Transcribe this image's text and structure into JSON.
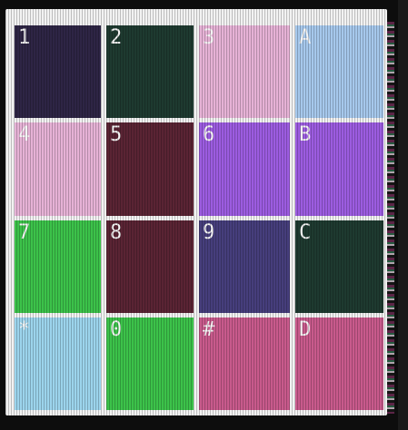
{
  "keypad": {
    "rows": [
      [
        {
          "label": "1",
          "color": "#2e2545"
        },
        {
          "label": "2",
          "color": "#1e3a30"
        },
        {
          "label": "3",
          "color": "#e6b2d6"
        },
        {
          "label": "A",
          "color": "#a6c8ec"
        }
      ],
      [
        {
          "label": "4",
          "color": "#e6b2d6"
        },
        {
          "label": "5",
          "color": "#5a2434"
        },
        {
          "label": "6",
          "color": "#9c5ce0"
        },
        {
          "label": "B",
          "color": "#9c5ce0"
        }
      ],
      [
        {
          "label": "7",
          "color": "#3cc24a"
        },
        {
          "label": "8",
          "color": "#5a2434"
        },
        {
          "label": "9",
          "color": "#463e7c"
        },
        {
          "label": "C",
          "color": "#1e3a30"
        }
      ],
      [
        {
          "label": "*",
          "color": "#9cd4ec"
        },
        {
          "label": "0",
          "color": "#3cc24a"
        },
        {
          "label": "#",
          "color": "#c85a8c"
        },
        {
          "label": "D",
          "color": "#c85a8c"
        }
      ]
    ]
  }
}
